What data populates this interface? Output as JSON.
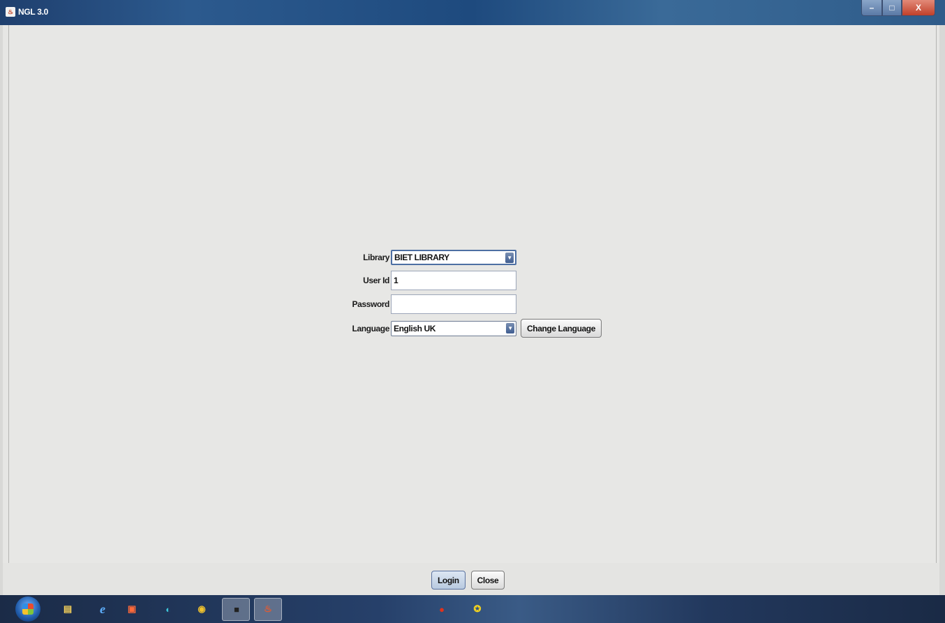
{
  "window": {
    "title": "NGL 3.0",
    "app_icon": "java-icon",
    "controls": {
      "minimize": "–",
      "maximize": "□",
      "close": "X"
    }
  },
  "form": {
    "library_label": "Library",
    "library_value": "BIET LIBRARY",
    "userid_label": "User Id",
    "userid_value": "1",
    "password_label": "Password",
    "password_value": "",
    "language_label": "Language",
    "language_value": "English UK",
    "change_language_button": "Change Language"
  },
  "buttons": {
    "login": "Login",
    "close": "Close"
  },
  "taskbar": {
    "pinned": [
      "start-orb",
      "file-explorer-icon",
      "internet-explorer-icon",
      "media-player-icon",
      "edge-icon",
      "chrome-icon",
      "terminal-icon",
      "java-app-icon"
    ],
    "tray": [
      "tray-app-icon-1",
      "tray-app-icon-2"
    ]
  }
}
